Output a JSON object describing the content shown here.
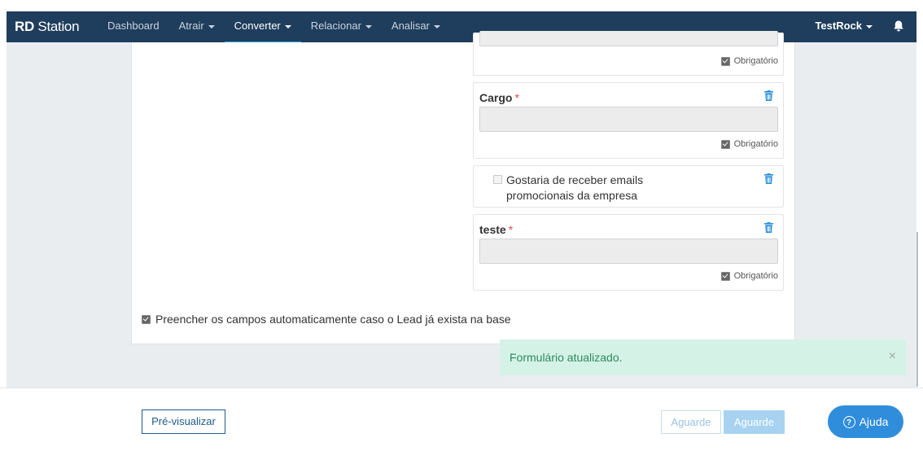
{
  "navbar": {
    "brand_bold": "RD",
    "brand_rest": "Station",
    "items": [
      {
        "label": "Dashboard",
        "caret": false,
        "active": false
      },
      {
        "label": "Atrair",
        "caret": true,
        "active": false
      },
      {
        "label": "Converter",
        "caret": true,
        "active": true
      },
      {
        "label": "Relacionar",
        "caret": true,
        "active": false
      },
      {
        "label": "Analisar",
        "caret": true,
        "active": false
      }
    ],
    "user": "TestRock",
    "bell_icon": "bell-icon"
  },
  "form": {
    "field_top": {
      "required_label": "Obrigatório"
    },
    "field_cargo": {
      "label": "Cargo",
      "required_mark": "*",
      "required_label": "Obrigatório"
    },
    "field_optin": {
      "text_line1": "Gostaria de receber emails",
      "text_line2": "promocionais da empresa"
    },
    "field_teste": {
      "label": "teste",
      "required_mark": "*",
      "required_label": "Obrigatório"
    },
    "autofill_text": "Preencher os campos automaticamente caso o Lead já exista na base"
  },
  "toast": {
    "message": "Formulário atualizado.",
    "close": "×"
  },
  "footer": {
    "preview_button": "Pré-visualizar",
    "wait_button_1": "Aguarde",
    "wait_button_2": "Aguarde",
    "help_button": "Ajuda",
    "help_icon_glyph": "?"
  },
  "colors": {
    "navbar": "#1f3d5c",
    "accent": "#2aa7e8",
    "toast_bg": "#d5f2e7",
    "toast_text": "#2c8a5c",
    "required": "#e5484d",
    "help_button": "#2f8ddb"
  }
}
